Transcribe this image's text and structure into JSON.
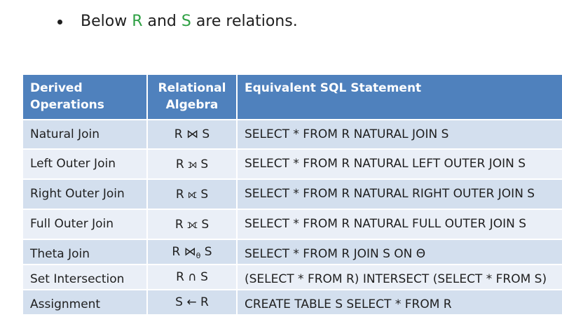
{
  "bullet": {
    "prefix": "Below ",
    "r": "R",
    "middle": " and ",
    "s": "S",
    "suffix": " are relations."
  },
  "table": {
    "headers": {
      "derived_operations": "Derived Operations",
      "relational_algebra": "Relational Algebra",
      "equivalent_sql": "Equivalent SQL Statement"
    },
    "rows": [
      {
        "operation": "Natural Join",
        "algebra": "R ⋈ S",
        "sql": "SELECT * FROM R NATURAL JOIN S"
      },
      {
        "operation": "Left Outer Join",
        "algebra": "R ⟕ S",
        "sql": "SELECT * FROM R NATURAL LEFT OUTER JOIN S"
      },
      {
        "operation": "Right Outer Join",
        "algebra": "R ⟖ S",
        "sql": "SELECT * FROM R NATURAL RIGHT OUTER JOIN S"
      },
      {
        "operation": "Full Outer Join",
        "algebra": "R ⟗ S",
        "sql": "SELECT * FROM R NATURAL FULL OUTER JOIN S"
      },
      {
        "operation": "Theta Join",
        "algebra_main": "R ⋈",
        "algebra_sub": "θ",
        "algebra_tail": " S",
        "sql": "SELECT * FROM R JOIN S ON Θ"
      },
      {
        "operation": "Set Intersection",
        "algebra": "R ∩ S",
        "sql": "(SELECT * FROM R) INTERSECT (SELECT * FROM S)"
      },
      {
        "operation": "Assignment",
        "algebra": "S ← R",
        "sql": "CREATE TABLE S SELECT * FROM R"
      }
    ]
  },
  "colors": {
    "header_bg": "#4f81bd",
    "row_odd_bg": "#d3dfee",
    "row_even_bg": "#eaeff7",
    "highlight_green": "#2ea043"
  }
}
